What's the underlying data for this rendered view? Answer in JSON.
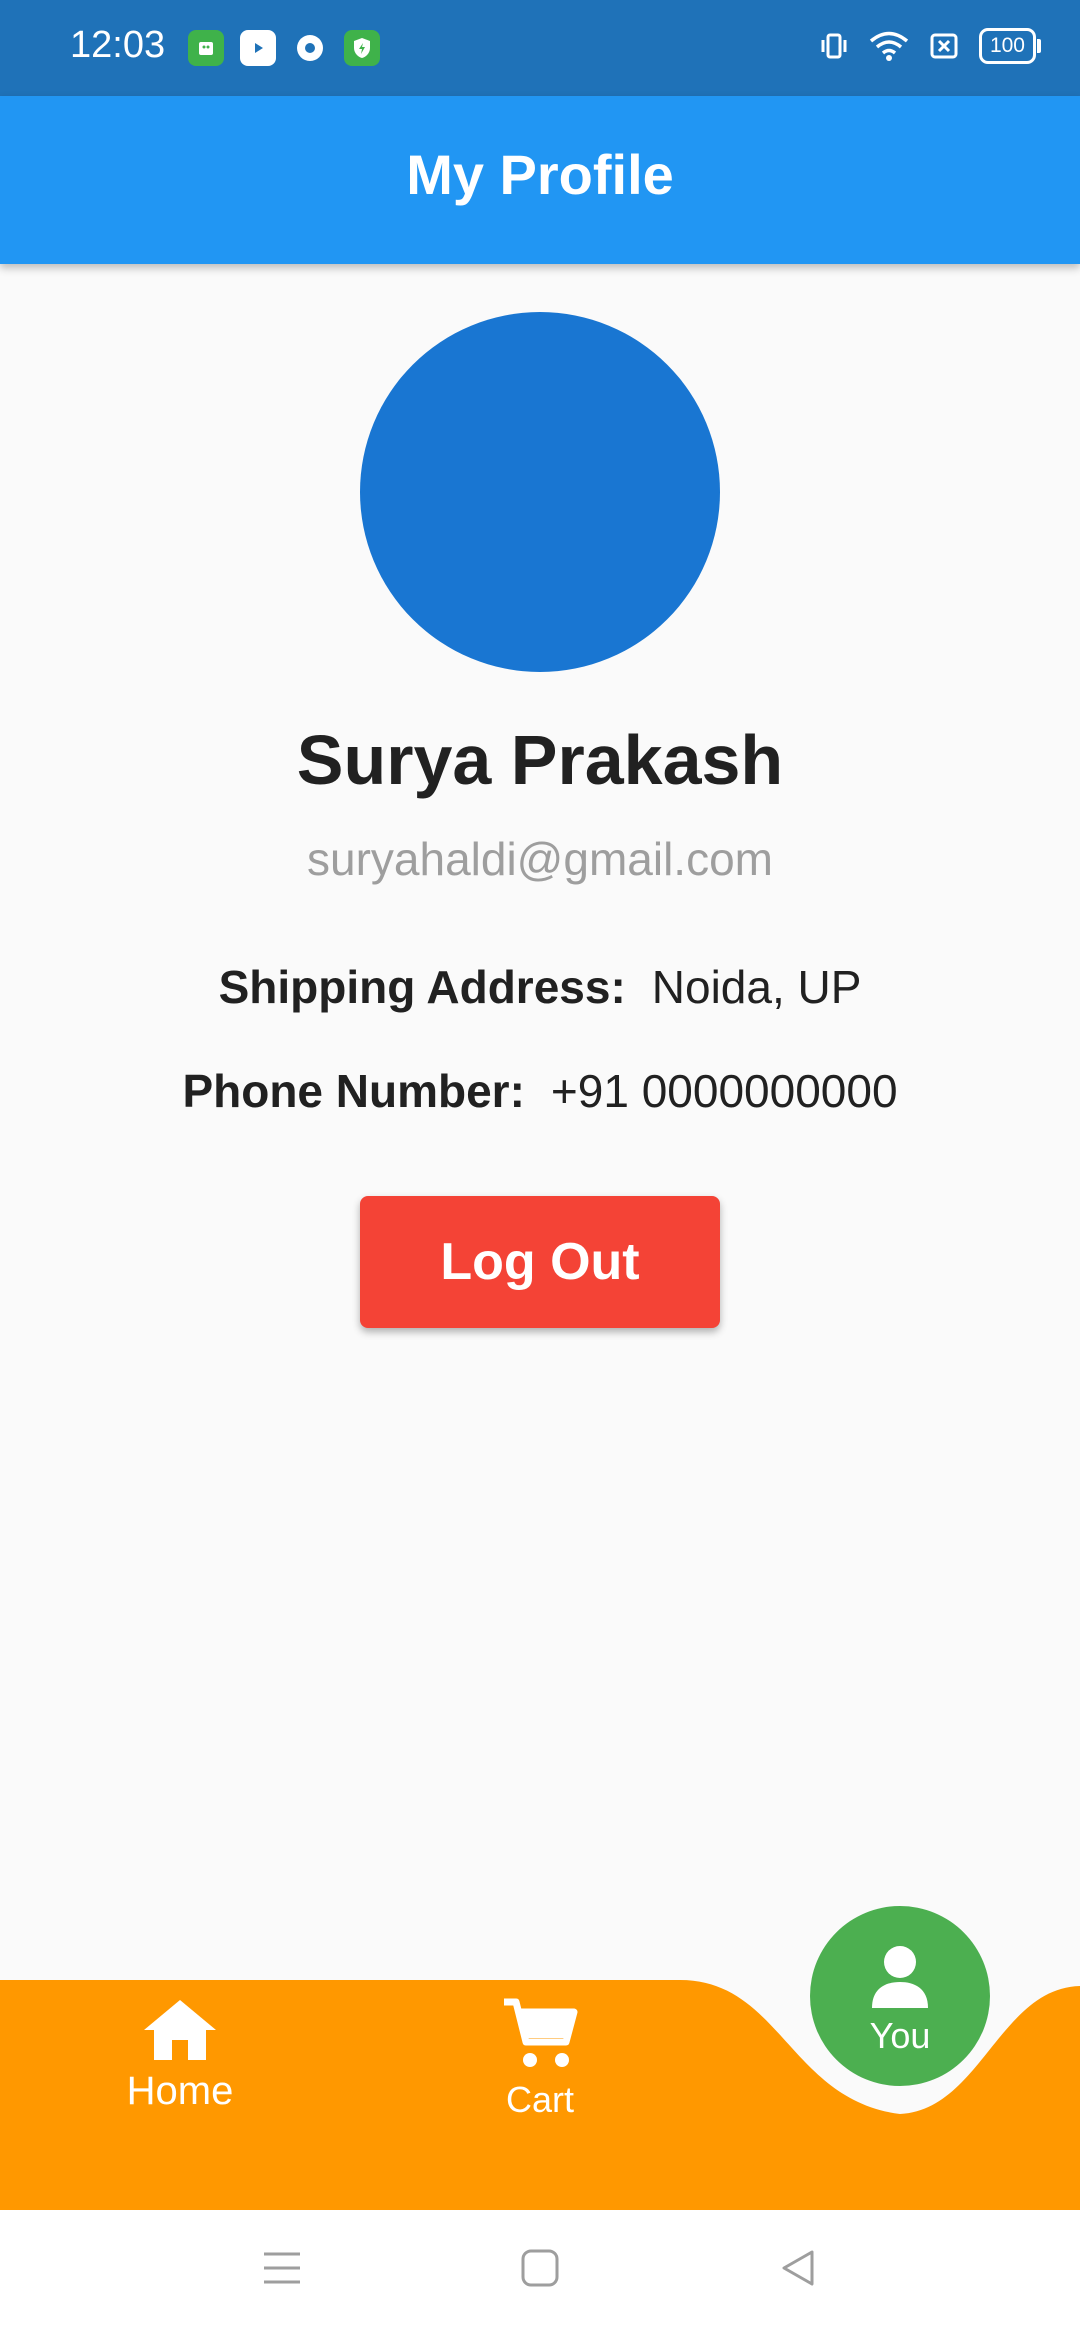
{
  "status_bar": {
    "time": "12:03",
    "notification_icons": [
      "store-icon",
      "youtube-icon",
      "chrome-icon",
      "shield-icon"
    ],
    "system_icons": [
      "vibrate-icon",
      "wifi-icon",
      "sim-icon",
      "battery-icon"
    ],
    "battery_level": "100"
  },
  "app_bar": {
    "title": "My Profile"
  },
  "profile": {
    "name": "Surya Prakash",
    "email": "suryahaldi@gmail.com",
    "shipping_label": "Shipping Address:",
    "shipping_value": "Noida, UP",
    "phone_label": "Phone Number:",
    "phone_value": "+91 0000000000",
    "logout_label": "Log Out"
  },
  "bottom_nav": {
    "items": [
      {
        "label": "Home",
        "icon": "home-icon"
      },
      {
        "label": "Cart",
        "icon": "cart-icon"
      },
      {
        "label": "You",
        "icon": "person-icon",
        "active": true
      }
    ]
  },
  "system_nav": {
    "buttons": [
      "menu-icon",
      "home-square-icon",
      "back-icon"
    ]
  },
  "colors": {
    "status_bar": "#1f72b8",
    "app_bar": "#2196f3",
    "avatar": "#1976d2",
    "logout_button": "#f44336",
    "bottom_nav": "#ff9800",
    "active_tab": "#4caf50"
  }
}
